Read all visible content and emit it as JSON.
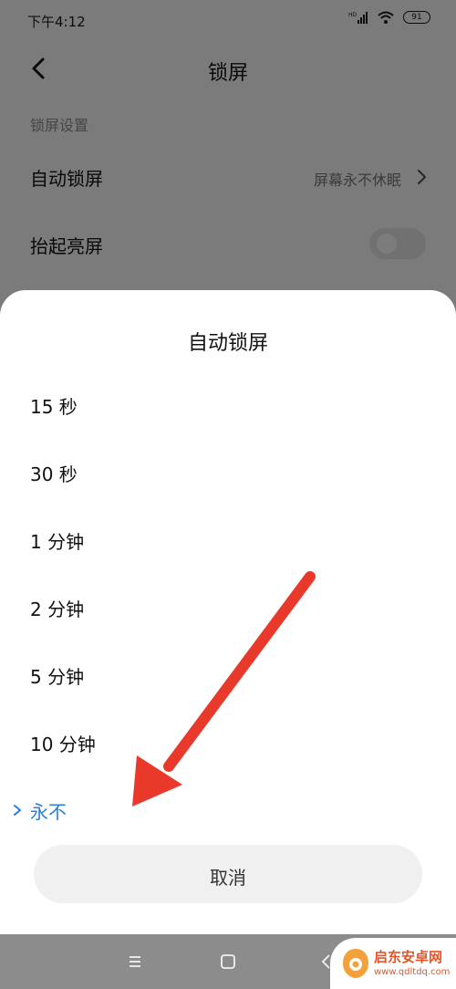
{
  "status_bar": {
    "time": "下午4:12",
    "network": "HD",
    "battery": "91"
  },
  "header": {
    "title": "锁屏",
    "back_icon": "chevron-left-icon"
  },
  "settings": {
    "section": "锁屏设置",
    "rows": [
      {
        "label": "自动锁屏",
        "value": "屏幕永不休眠"
      },
      {
        "label": "抬起亮屏",
        "toggle_on": false
      }
    ]
  },
  "sheet": {
    "title": "自动锁屏",
    "options": [
      {
        "label": "15 秒"
      },
      {
        "label": "30 秒"
      },
      {
        "label": "1 分钟"
      },
      {
        "label": "2 分钟"
      },
      {
        "label": "5 分钟"
      },
      {
        "label": "10 分钟"
      },
      {
        "label": "永不",
        "selected": true
      }
    ],
    "cancel": "取消"
  },
  "navbar": {
    "icons": [
      "menu-icon",
      "home-square-icon",
      "back-chevron-icon"
    ]
  },
  "watermark": {
    "name": "启东安卓网",
    "url": "www.qdltdq.com"
  },
  "colors": {
    "accent": "#2b7fd8",
    "arrow": "#e8392b"
  }
}
